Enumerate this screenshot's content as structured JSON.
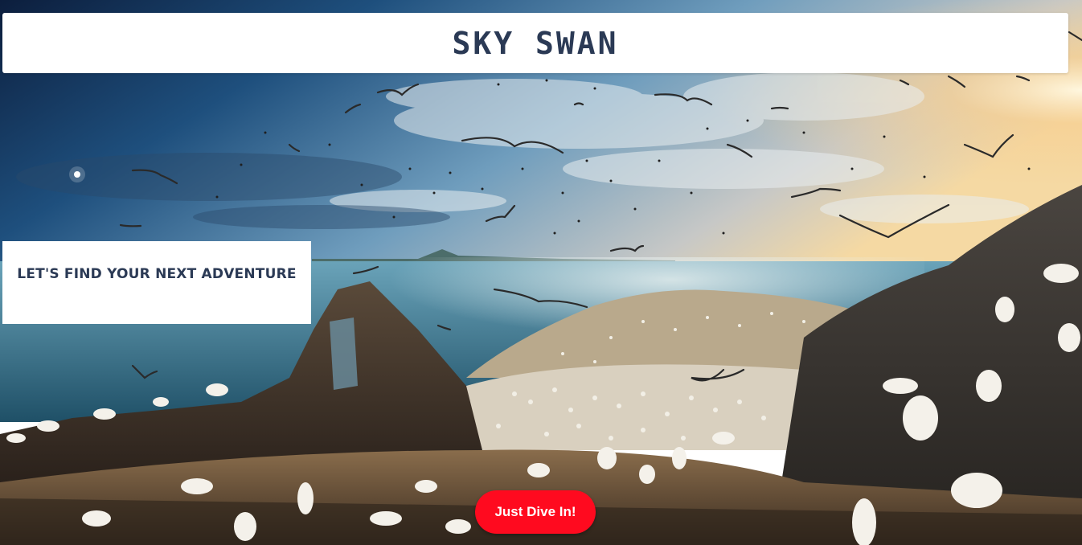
{
  "header": {
    "title": "SKY SWAN"
  },
  "hero": {
    "tagline": "LET'S FIND YOUR NEXT ADVENTURE",
    "cta_label": "Just Dive In!"
  },
  "colors": {
    "title_text": "#2b3a55",
    "cta_background": "#ff0a1f",
    "cta_text": "#ffffff",
    "panel_background": "#ffffff"
  }
}
